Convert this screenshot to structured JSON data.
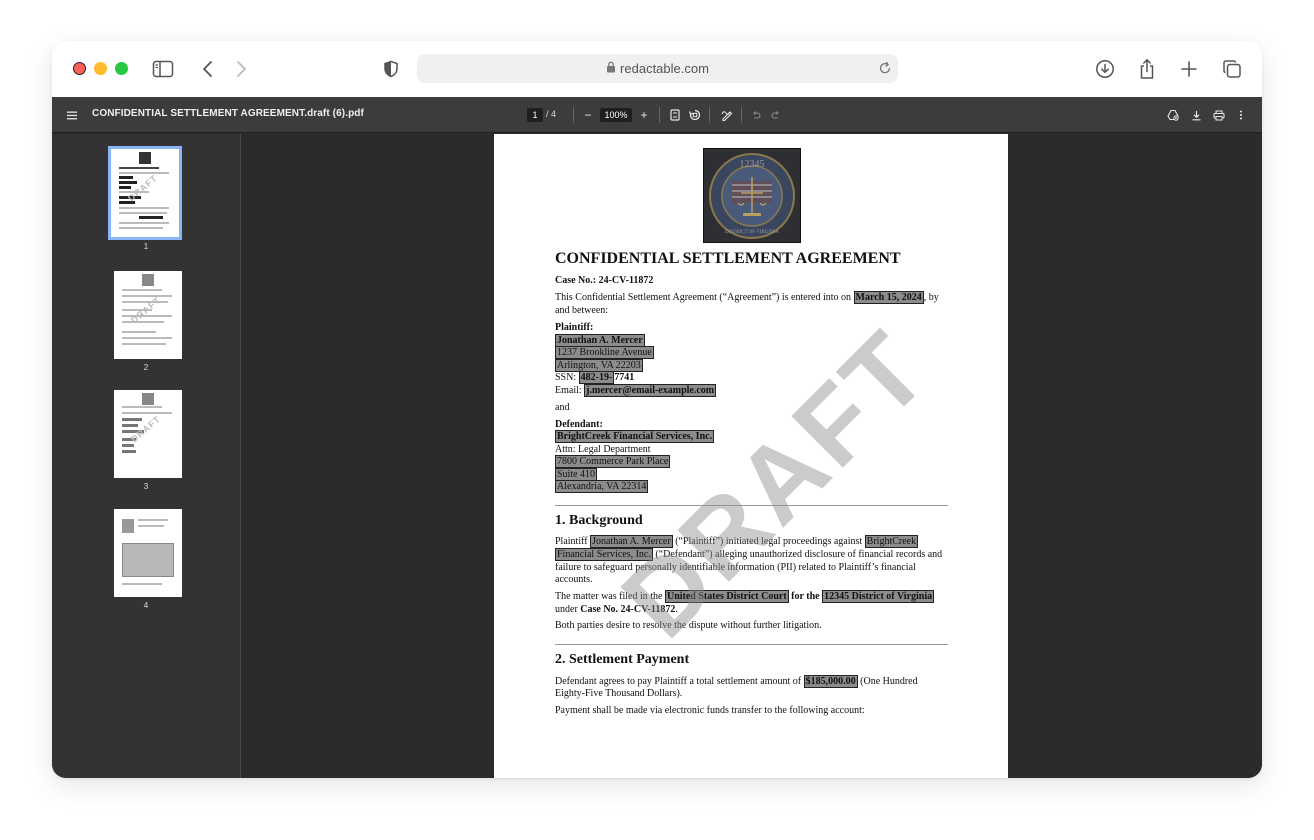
{
  "browser": {
    "url": "redactable.com",
    "icons": [
      "sidebar-icon",
      "back-icon",
      "forward-icon",
      "shield-icon",
      "lock-icon",
      "reload-icon",
      "download-icon",
      "share-icon",
      "new-tab-icon",
      "tabs-icon"
    ]
  },
  "pdf_toolbar": {
    "filename": "CONFIDENTIAL SETTLEMENT AGREEMENT.draft (6).pdf",
    "current_page": "1",
    "page_total": "/  4",
    "zoom": "100%",
    "zoom_out": "−",
    "zoom_in": "+"
  },
  "thumbnails": [
    {
      "label": "1",
      "stamp": "DRAFT"
    },
    {
      "label": "2",
      "stamp": "DRAFT"
    },
    {
      "label": "3",
      "stamp": "DRAFT"
    },
    {
      "label": "4"
    }
  ],
  "document": {
    "seal_top_text": "12345",
    "seal_bottom_text": "DISTRICT OF VIRGINIA",
    "title": "CONFIDENTIAL SETTLEMENT AGREEMENT",
    "case_no": "Case No.: 24-CV-11872",
    "intro_1": "This Confidential Settlement Agreement (“Agreement”) is entered into on ",
    "intro_date": "March 15, 2024",
    "intro_2": ", by",
    "intro_3": "and between:",
    "plaintiff_label": "Plaintiff:",
    "plaintiff_name": "Jonathan A. Mercer",
    "plaintiff_addr1": "1237 Brookline Avenue",
    "plaintiff_addr2": "Arlington, VA 22203",
    "ssn_label": "SSN: ",
    "ssn_redacted": "482-19-",
    "ssn_rest": "7741",
    "email_label": "Email: ",
    "email": "j.mercer@email-example.com",
    "and": "and",
    "defendant_label": "Defendant:",
    "defendant_name": "BrightCreek Financial Services, Inc.",
    "defendant_attn": "Attn: Legal Department",
    "defendant_addr1": "7800 Commerce Park Place",
    "defendant_addr2": "Suite 410",
    "defendant_addr3": "Alexandria, VA 22314",
    "section1_title": "1. Background",
    "bg_p1_a": "Plaintiff ",
    "bg_p1_name": "Jonathan A. Mercer",
    "bg_p1_b": " (“Plaintiff”) initiated legal proceedings against ",
    "bg_p1_c": "BrightCreek",
    "bg_p1_d": "Financial Services, Inc.",
    "bg_p1_e": " (“Defendant”) alleging unauthorized disclosure of financial records and",
    "bg_p1_f": "failure to safeguard personally identifiable information (PII) related to Plaintiff’s financial",
    "bg_p1_g": "accounts.",
    "bg_p2_a": "The matter was filed in the ",
    "bg_p2_court": "United States District Court",
    "bg_p2_b": " for the ",
    "bg_p2_district": "12345 District of Virginia",
    "bg_p2_c": "under ",
    "bg_p2_case": "Case No. 24-CV-11872",
    "bg_p2_d": ".",
    "bg_p3": "Both parties desire to resolve the dispute without further litigation.",
    "section2_title": "2. Settlement Payment",
    "sp_p1_a": "Defendant agrees to pay Plaintiff a total settlement amount of ",
    "sp_amount": "$185,000.00",
    "sp_p1_b": " (One Hundred",
    "sp_p1_c": "Eighty-Five Thousand Dollars).",
    "sp_p2": "Payment shall be made via electronic funds transfer to the following account:",
    "watermark": "DRAFT"
  },
  "colors": {
    "viewer_bg": "#2b2b2c",
    "pdf_bar": "#3c3c3d",
    "thumb_selected": "#8ab4f8",
    "redaction": "#8c8c8c"
  }
}
